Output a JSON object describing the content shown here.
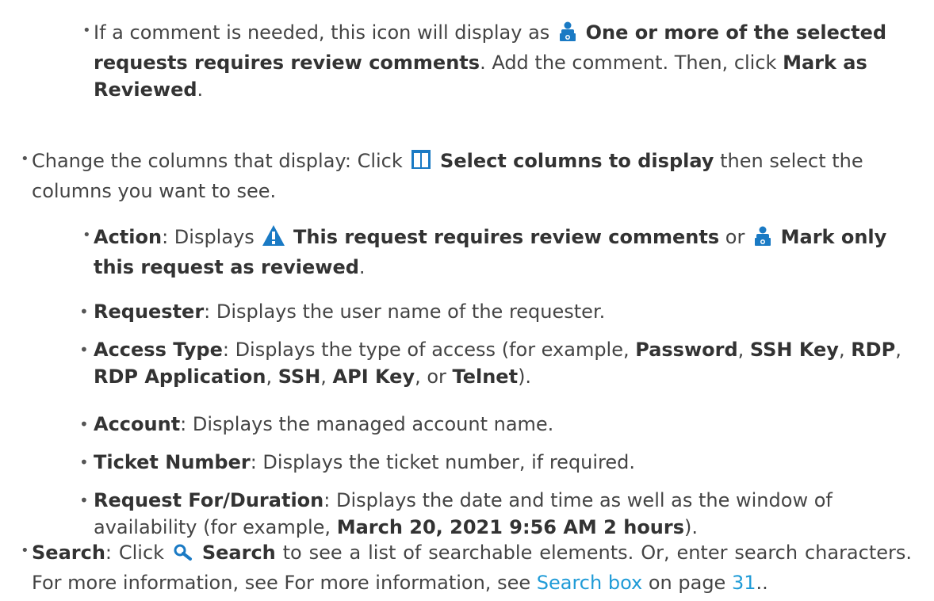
{
  "items": [
    {
      "p1": "If a comment is needed, this icon will display as",
      "b1": "One or more of the selected requests requires review comments",
      "p2": ". Add the comment. Then, click ",
      "b2": "Mark as Reviewed",
      "p3": "."
    },
    {
      "p1": "Change the columns that display: Click",
      "b1": "Select columns to display",
      "p2": "then select the columns you want to see."
    }
  ],
  "columns": [
    {
      "name": "Action",
      "p1": ": Displays",
      "b1": "This request requires review comments",
      "p2": "or",
      "b2": "Mark only this request as reviewed",
      "p3": "."
    },
    {
      "name": "Requester",
      "text": ": Displays the user name of the requester."
    },
    {
      "name": "Access Type",
      "p1": ": Displays the type of access (for example, ",
      "k1": "Password",
      "k2": "SSH Key",
      "k3": "RDP",
      "k4": "RDP Application",
      "k5": "SSH",
      "k6": "API Key",
      "k7": "Telnet",
      "sep": ", ",
      "or": ", or ",
      "end": ")."
    },
    {
      "name": "Account",
      "text": ": Displays the managed account name."
    },
    {
      "name": "Ticket Number",
      "text": ": Displays the ticket number, if required."
    },
    {
      "name": "Request For/Duration",
      "p1": ": Displays the date and time as well as the window of availability (for example, ",
      "b1": "March 20, 2021 9:56 AM 2 hours",
      "end": ")."
    }
  ],
  "search": {
    "name": "Search",
    "p1": ": Click",
    "b1": "Search",
    "p2": "to see a list of searchable elements. Or, enter search characters. For more information, see For more information, see",
    "link": "Search box",
    "p3": "on page",
    "page": "31",
    "end": ".."
  },
  "colors": {
    "icon_blue": "#1a7ac4",
    "link": "#1f9bd7"
  },
  "icons": [
    "reviewer-icon",
    "columns-icon",
    "warning-icon",
    "reviewer-icon",
    "search-icon"
  ],
  "bullets": {
    "square": "•",
    "round": "•"
  }
}
